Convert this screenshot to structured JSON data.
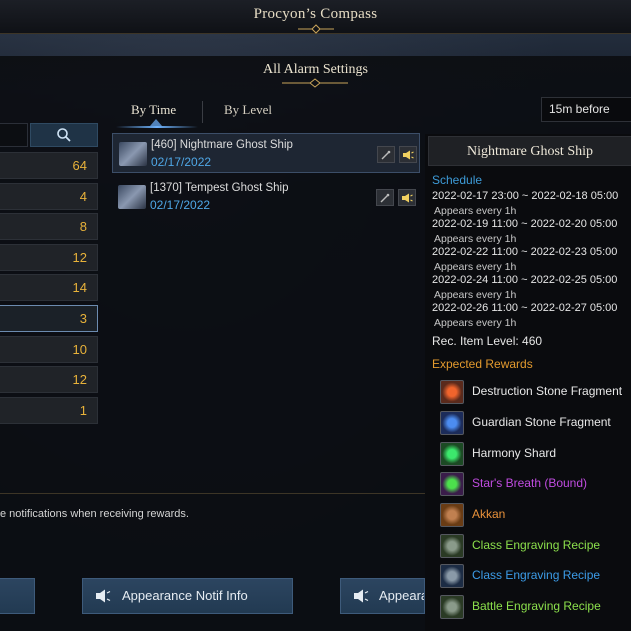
{
  "window": {
    "title": "Procyon’s Compass"
  },
  "dialog": {
    "title": "All Alarm Settings"
  },
  "tabs": [
    {
      "label": "By Time",
      "active": true
    },
    {
      "label": "By Level",
      "active": false
    }
  ],
  "notify_before": {
    "selected": "15m before"
  },
  "search": {
    "icon": "search-icon"
  },
  "categories": [
    {
      "count": "64"
    },
    {
      "count": "4"
    },
    {
      "count": "8"
    },
    {
      "count": "12"
    },
    {
      "count": "14"
    },
    {
      "count": "3",
      "active": true
    },
    {
      "count": "10"
    },
    {
      "count": "12"
    },
    {
      "count": "1"
    }
  ],
  "entries": [
    {
      "name": "[460] Nightmare Ghost Ship",
      "date": "02/17/2022",
      "selected": true
    },
    {
      "name": "[1370] Tempest Ghost Ship",
      "date": "02/17/2022",
      "selected": false
    }
  ],
  "detail": {
    "title": "Nightmare Ghost Ship",
    "schedule_label": "Schedule",
    "schedule": [
      {
        "range": "2022-02-17 23:00 ~ 2022-02-18 05:00",
        "note": "Appears every 1h"
      },
      {
        "range": "2022-02-19 11:00 ~ 2022-02-20 05:00",
        "note": "Appears every 1h"
      },
      {
        "range": "2022-02-22 11:00 ~ 2022-02-23 05:00",
        "note": "Appears every 1h"
      },
      {
        "range": "2022-02-24 11:00 ~ 2022-02-25 05:00",
        "note": "Appears every 1h"
      },
      {
        "range": "2022-02-26 11:00 ~ 2022-02-27 05:00",
        "note": "Appears every 1h"
      }
    ],
    "rec_item_level": "Rec. Item Level: 460",
    "rewards_label": "Expected Rewards",
    "rewards": [
      {
        "name": "Destruction Stone Fragment",
        "color": "#e8e8e8",
        "icon_bg": "#5a2a1c",
        "icon_fg": "#f0642c"
      },
      {
        "name": "Guardian Stone Fragment",
        "color": "#e8e8e8",
        "icon_bg": "#1c2c5a",
        "icon_fg": "#4c8cf0"
      },
      {
        "name": "Harmony Shard",
        "color": "#e8e8e8",
        "icon_bg": "#1c4a24",
        "icon_fg": "#3ce86c"
      },
      {
        "name": "Star's Breath (Bound)",
        "color": "#c04ce0",
        "icon_bg": "#3a1c4a",
        "icon_fg": "#4ce04c"
      },
      {
        "name": "Akkan",
        "color": "#e8913a",
        "icon_bg": "#6a3c14",
        "icon_fg": "#c08050"
      },
      {
        "name": "Class Engraving Recipe",
        "color": "#8ce04c",
        "icon_bg": "#2a3a24",
        "icon_fg": "#8a9a8a"
      },
      {
        "name": "Class Engraving Recipe",
        "color": "#3c9ce8",
        "icon_bg": "#1c2c44",
        "icon_fg": "#8a9aa8"
      },
      {
        "name": "Battle Engraving Recipe",
        "color": "#8ce04c",
        "icon_bg": "#2a3a24",
        "icon_fg": "#8a9a8a"
      }
    ]
  },
  "footer": {
    "text": "e notifications when receiving rewards.",
    "buttons": {
      "info_label": "Appearance Notif Info",
      "right_label": "Appeara"
    }
  },
  "colors": {
    "accent_blue": "#4fa7e6",
    "count_gold": "#e8b23a",
    "section_orange": "#e39a2e"
  }
}
